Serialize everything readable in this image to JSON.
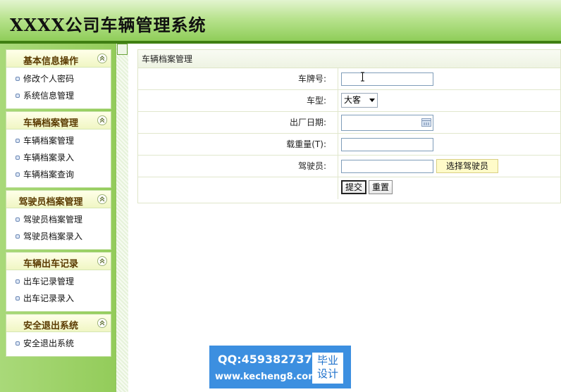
{
  "header": {
    "title": "XXXX公司车辆管理系统"
  },
  "sidebar": {
    "groups": [
      {
        "title": "基本信息操作",
        "items": [
          "修改个人密码",
          "系统信息管理"
        ]
      },
      {
        "title": "车辆档案管理",
        "items": [
          "车辆档案管理",
          "车辆档案录入",
          "车辆档案查询"
        ]
      },
      {
        "title": "驾驶员档案管理",
        "items": [
          "驾驶员档案管理",
          "驾驶员档案录入"
        ]
      },
      {
        "title": "车辆出车记录",
        "items": [
          "出车记录管理",
          "出车记录录入"
        ]
      },
      {
        "title": "安全退出系统",
        "items": [
          "安全退出系统"
        ]
      }
    ]
  },
  "main": {
    "panel_title": "车辆档案管理",
    "form": {
      "plate_label": "车牌号:",
      "plate_value": "",
      "type_label": "车型:",
      "type_value": "大客",
      "date_label": "出厂日期:",
      "date_value": "",
      "load_label": "载重量(T):",
      "load_value": "",
      "driver_label": "驾驶员:",
      "driver_value": "",
      "pick_driver_label": "选择驾驶员",
      "submit_label": "提交",
      "reset_label": "重置"
    }
  },
  "watermark": {
    "qq": "QQ:459382737",
    "site": "www.kecheng8.com",
    "badge_line1": "毕业",
    "badge_line2": "设计"
  },
  "colors": {
    "header_green": "#8fcd59",
    "header_border": "#3f7f12",
    "watermark_blue": "#3c8fe0"
  }
}
